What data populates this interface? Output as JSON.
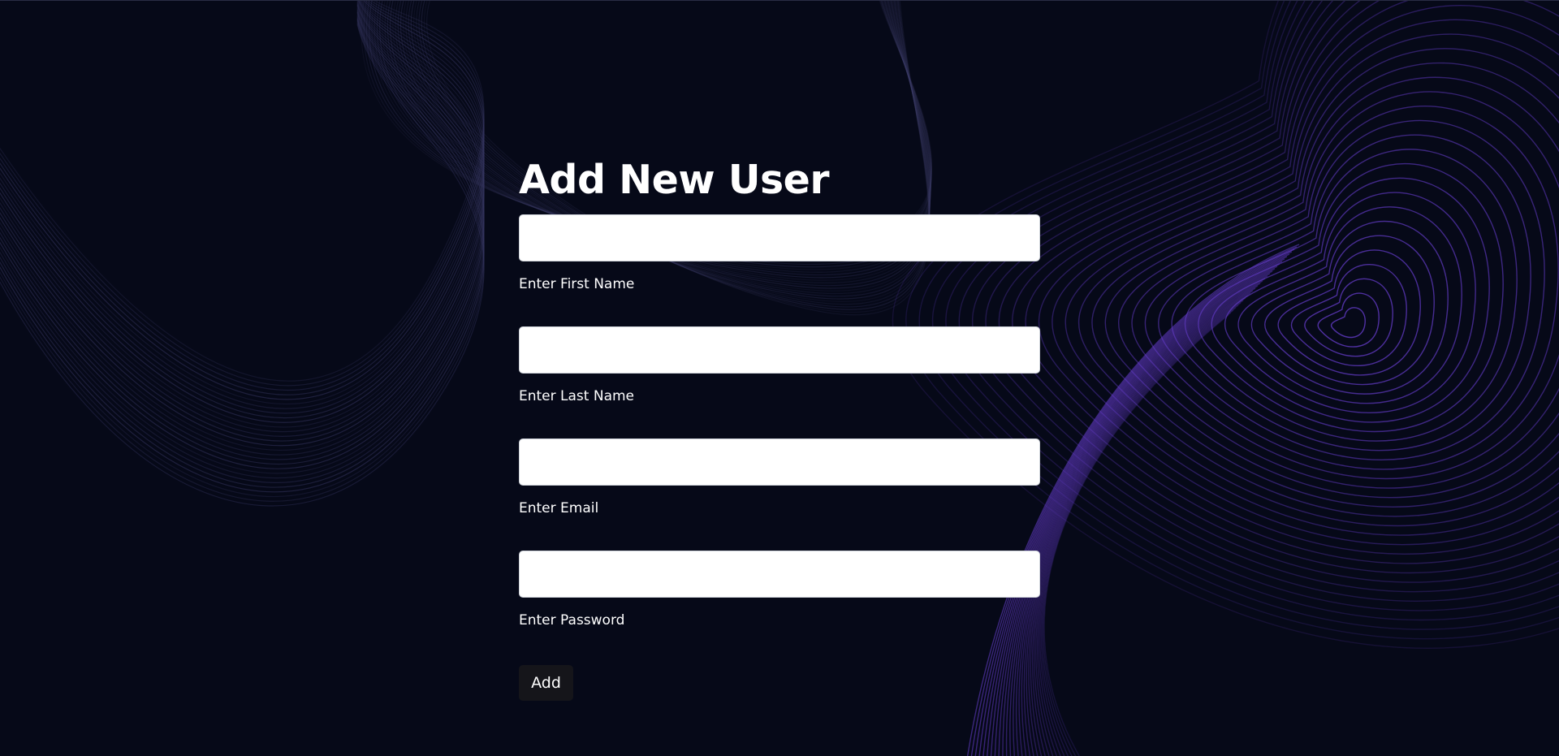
{
  "form": {
    "title": "Add New User",
    "fields": [
      {
        "label": "Enter First Name",
        "value": "",
        "placeholder": ""
      },
      {
        "label": "Enter Last Name",
        "value": "",
        "placeholder": ""
      },
      {
        "label": "Enter Email",
        "value": "",
        "placeholder": ""
      },
      {
        "label": "Enter Password",
        "value": "",
        "placeholder": ""
      }
    ],
    "submit_label": "Add"
  },
  "colors": {
    "background": "#060918",
    "accent": "#6a3fd4",
    "wave_left": "#3a3a66",
    "button": "#15151a"
  }
}
